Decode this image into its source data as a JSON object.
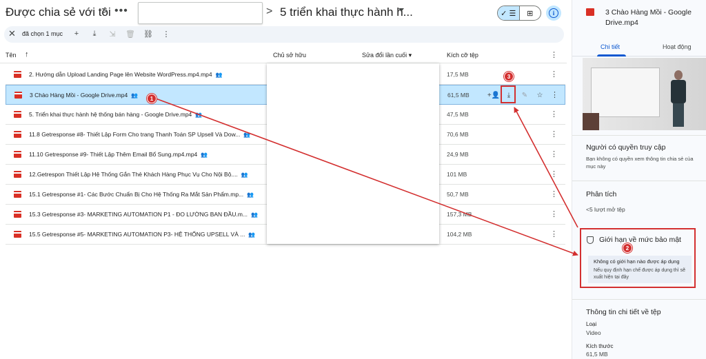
{
  "header": {
    "root": "Được chia sẻ với tôi",
    "sep": ">",
    "more": "•••",
    "current": "5 triển khai thực hành h...",
    "view_list_icon": "✓ ☰",
    "view_grid_icon": "⊞",
    "info_icon": "i"
  },
  "selection": {
    "close_icon": "✕",
    "count": "đã chọn 1 mục",
    "actions": [
      {
        "icon": "person-add-icon",
        "glyph": "+"
      },
      {
        "icon": "download-icon",
        "glyph": "⤓"
      },
      {
        "icon": "move-icon",
        "glyph": "⇲"
      },
      {
        "icon": "trash-icon",
        "glyph": "🗑"
      },
      {
        "icon": "link-icon",
        "glyph": "⛓"
      },
      {
        "icon": "more-icon",
        "glyph": "⋮"
      }
    ]
  },
  "table": {
    "columns": {
      "name": "Tên",
      "sort_icon": "↑",
      "owner": "Chủ sở hữu",
      "modified": "Sửa đổi lần cuối ▾",
      "size": "Kích cỡ tệp",
      "more": "⋮"
    },
    "rows": [
      {
        "name": "2. Hướng dẫn Upload Landing Page lên Website WordPress.mp4.mp4",
        "shared": "👥",
        "size": "17,5 MB",
        "more": "⋮"
      },
      {
        "name": "3 Chào Hàng Mồi - Google Drive.mp4",
        "shared": "👥",
        "size": "61,5 MB",
        "more": "⋮"
      },
      {
        "name": "5. Triển khai thực hành hệ thống bán hàng - Google Drive.mp4",
        "shared": "👥",
        "size": "47,5 MB",
        "more": "⋮"
      },
      {
        "name": "11.8 Getresponse #8- Thiết Lập Form Cho trang Thanh Toán SP Upsell Và Dow...",
        "shared": "👥",
        "size": "70,6 MB",
        "more": "⋮"
      },
      {
        "name": "11.10 Getresponse #9- Thiết Lập Thêm Email Bổ Sung.mp4.mp4",
        "shared": "👥",
        "size": "24,9 MB",
        "more": "⋮"
      },
      {
        "name": "12.Getrespon Thiết Lập Hệ Thống Gắn Thẻ Khách Hàng Phục Vụ Cho Nội Bộ....",
        "shared": "👥",
        "size": "101 MB",
        "more": "⋮"
      },
      {
        "name": "15.1 Getresponse #1- Các Bước Chuẩn Bị Cho Hệ Thống Ra Mắt Sản Phẩm.mp...",
        "shared": "👥",
        "size": "50,7 MB",
        "more": "⋮"
      },
      {
        "name": "15.3 Getresponse #3- MARKETING AUTOMATION P1 - ĐO LƯỜNG BAN ĐẦU.m...",
        "shared": "👥",
        "size": "157,3 MB",
        "more": "⋮"
      },
      {
        "name": "15.5 Getresponse #5- MARKETING AUTOMATION P3- HỆ THỐNG UPSELL VÀ ...",
        "shared": "👥",
        "size": "104,2 MB",
        "more": "⋮"
      }
    ],
    "row_actions": {
      "share": "+👤",
      "download": "⤓",
      "rename": "✎",
      "star": "☆"
    }
  },
  "panel": {
    "title": "3 Chào Hàng Mồi - Google Drive.mp4",
    "tabs": [
      "Chi tiết",
      "Hoạt động"
    ],
    "access_title": "Người có quyền truy cập",
    "access_text": "Bạn không có quyền xem thông tin chia sẻ của mục này",
    "analytics_title": "Phân tích",
    "analytics_text": "<5 lượt mở tệp",
    "security_title": "Giới hạn về mức bảo mật",
    "security_line1": "Không có giới hạn nào được áp dụng",
    "security_line2": "Nếu quy định hạn chế được áp dụng thì sẽ xuất hiện tại đây",
    "details_title": "Thông tin chi tiết về tệp",
    "type_label": "Loại",
    "type_value": "Video",
    "size_label": "Kích thước",
    "size_value": "61,5 MB"
  },
  "annotations": {
    "badge1": "1",
    "badge2": "2",
    "badge3": "3",
    "color": "#d32f2f"
  },
  "colors": {
    "accent": "#0b57d0",
    "selected_row": "#c2e7ff",
    "file_icon": "#d93025"
  }
}
